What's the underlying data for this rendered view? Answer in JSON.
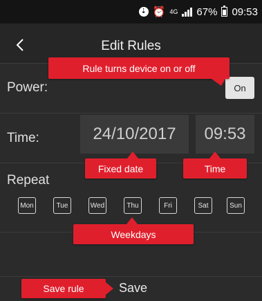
{
  "status_bar": {
    "battery_percent": "67%",
    "clock": "09:53",
    "network_label": "4G"
  },
  "header": {
    "title": "Edit Rules"
  },
  "power": {
    "label": "Power:",
    "toggle_label": "On"
  },
  "time": {
    "label": "Time:",
    "date_value": "24/10/2017",
    "time_value": "09:53"
  },
  "repeat": {
    "label": "Repeat",
    "days": [
      "Mon",
      "Tue",
      "Wed",
      "Thu",
      "Fri",
      "Sat",
      "Sun"
    ],
    "selected": "Thu"
  },
  "save": {
    "label": "Save"
  },
  "annotations": {
    "power": "Rule turns device on or off",
    "date": "Fixed date",
    "time": "Time",
    "weekdays": "Weekdays",
    "save": "Save rule"
  },
  "colors": {
    "callout": "#e01f2d",
    "background": "#2b2b2b",
    "field": "#3a3a3a"
  }
}
